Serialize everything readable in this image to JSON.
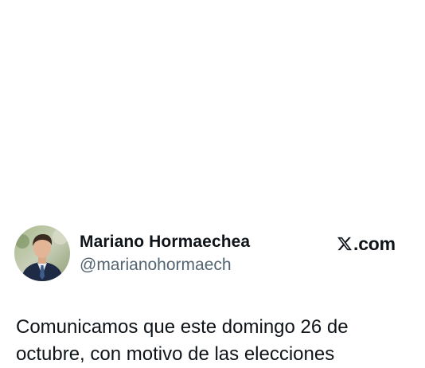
{
  "author": {
    "display_name": "Mariano Hormaechea",
    "handle": "@marianohormaech",
    "avatar_icon": "profile-photo"
  },
  "brand": {
    "text": ".com",
    "icon": "x-logo-icon"
  },
  "tweet": {
    "lines": [
      "Comunicamos que este domingo 26 de",
      "octubre, con motivo de las elecciones"
    ]
  },
  "colors": {
    "text": "#0f1419",
    "secondary_text": "#536471",
    "background": "#ffffff"
  }
}
